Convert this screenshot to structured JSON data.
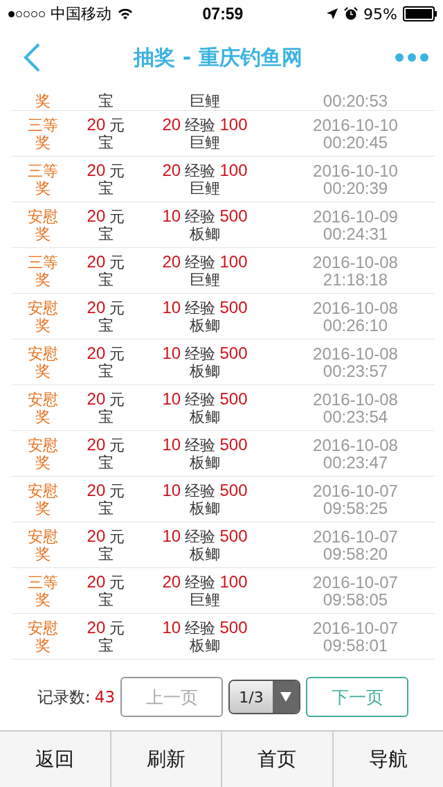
{
  "status_bar": {
    "carrier": "中国移动",
    "time": "07:59",
    "battery": "95%"
  },
  "nav": {
    "title": "抽奖 - 重庆钓鱼网"
  },
  "rows": [
    {
      "kind": "partial",
      "prize": "奖",
      "unit_bottom": "宝",
      "fish": "巨鲤",
      "time": "00:20:53"
    },
    {
      "kind": "full",
      "prize": "三等奖",
      "coins": "20",
      "unit_top": "元",
      "unit_bottom": "宝",
      "exp": "20",
      "exp_label": "经验",
      "weight": "100",
      "fish": "巨鲤",
      "date": "2016-10-10",
      "time": "00:20:45"
    },
    {
      "kind": "full",
      "prize": "三等奖",
      "coins": "20",
      "unit_top": "元",
      "unit_bottom": "宝",
      "exp": "20",
      "exp_label": "经验",
      "weight": "100",
      "fish": "巨鲤",
      "date": "2016-10-10",
      "time": "00:20:39"
    },
    {
      "kind": "full",
      "prize": "安慰奖",
      "coins": "20",
      "unit_top": "元",
      "unit_bottom": "宝",
      "exp": "10",
      "exp_label": "经验",
      "weight": "500",
      "fish": "板鲫",
      "date": "2016-10-09",
      "time": "00:24:31"
    },
    {
      "kind": "full",
      "prize": "三等奖",
      "coins": "20",
      "unit_top": "元",
      "unit_bottom": "宝",
      "exp": "20",
      "exp_label": "经验",
      "weight": "100",
      "fish": "巨鲤",
      "date": "2016-10-08",
      "time": "21:18:18"
    },
    {
      "kind": "full",
      "prize": "安慰奖",
      "coins": "20",
      "unit_top": "元",
      "unit_bottom": "宝",
      "exp": "10",
      "exp_label": "经验",
      "weight": "500",
      "fish": "板鲫",
      "date": "2016-10-08",
      "time": "00:26:10"
    },
    {
      "kind": "full",
      "prize": "安慰奖",
      "coins": "20",
      "unit_top": "元",
      "unit_bottom": "宝",
      "exp": "10",
      "exp_label": "经验",
      "weight": "500",
      "fish": "板鲫",
      "date": "2016-10-08",
      "time": "00:23:57"
    },
    {
      "kind": "full",
      "prize": "安慰奖",
      "coins": "20",
      "unit_top": "元",
      "unit_bottom": "宝",
      "exp": "10",
      "exp_label": "经验",
      "weight": "500",
      "fish": "板鲫",
      "date": "2016-10-08",
      "time": "00:23:54"
    },
    {
      "kind": "full",
      "prize": "安慰奖",
      "coins": "20",
      "unit_top": "元",
      "unit_bottom": "宝",
      "exp": "10",
      "exp_label": "经验",
      "weight": "500",
      "fish": "板鲫",
      "date": "2016-10-08",
      "time": "00:23:47"
    },
    {
      "kind": "full",
      "prize": "安慰奖",
      "coins": "20",
      "unit_top": "元",
      "unit_bottom": "宝",
      "exp": "10",
      "exp_label": "经验",
      "weight": "500",
      "fish": "板鲫",
      "date": "2016-10-07",
      "time": "09:58:25"
    },
    {
      "kind": "full",
      "prize": "安慰奖",
      "coins": "20",
      "unit_top": "元",
      "unit_bottom": "宝",
      "exp": "10",
      "exp_label": "经验",
      "weight": "500",
      "fish": "板鲫",
      "date": "2016-10-07",
      "time": "09:58:20"
    },
    {
      "kind": "full",
      "prize": "三等奖",
      "coins": "20",
      "unit_top": "元",
      "unit_bottom": "宝",
      "exp": "20",
      "exp_label": "经验",
      "weight": "100",
      "fish": "巨鲤",
      "date": "2016-10-07",
      "time": "09:58:05"
    },
    {
      "kind": "full",
      "prize": "安慰奖",
      "coins": "20",
      "unit_top": "元",
      "unit_bottom": "宝",
      "exp": "10",
      "exp_label": "经验",
      "weight": "500",
      "fish": "板鲫",
      "date": "2016-10-07",
      "time": "09:58:01"
    }
  ],
  "pager": {
    "count_label": "记录数:",
    "count": "43",
    "prev": "上一页",
    "prev_disabled": true,
    "page": "1/3",
    "next": "下一页"
  },
  "tabbar": [
    "返回",
    "刷新",
    "首页",
    "导航"
  ]
}
